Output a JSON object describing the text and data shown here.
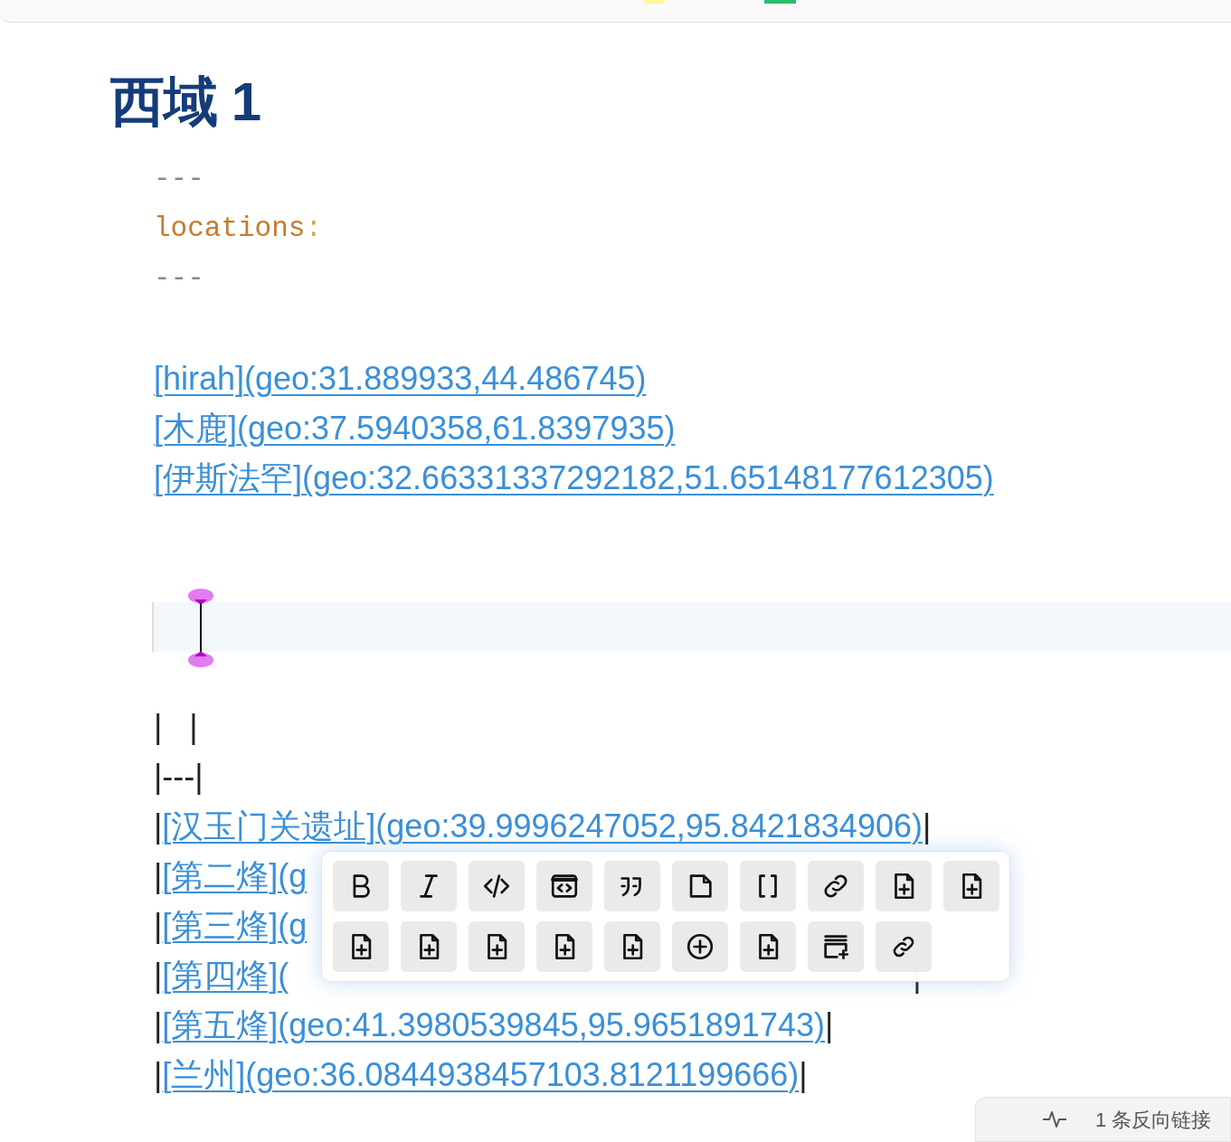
{
  "top_toolbar": {
    "swatches": [
      {
        "color": "#fff59d"
      },
      {
        "color": "#2ebd6b"
      }
    ]
  },
  "title": "西域 1",
  "frontmatter": [
    {
      "kind": "dashes",
      "text": "---"
    },
    {
      "kind": "key",
      "text": "locations",
      "colon": ":"
    },
    {
      "kind": "dashes",
      "text": "---"
    }
  ],
  "links": [
    "[hirah](geo:31.889933,44.486745)",
    "[木鹿](geo:37.5940358,61.8397935)",
    "[伊斯法罕](geo:32.66331337292182,51.65148177612305)"
  ],
  "cursor_line": {
    "active": true
  },
  "table_header": [
    "|   |",
    "|---|"
  ],
  "table_rows": [
    {
      "left": "|",
      "link": "[汉玉门关遗址](geo:39.9996247052,95.8421834906)",
      "right": "|"
    },
    {
      "left": "|",
      "link": "[第二烽](g"
    },
    {
      "left": "|",
      "link": "[第三烽](g"
    },
    {
      "left": "|",
      "link": "[第四烽](",
      "right": "|",
      "kind": "covered"
    },
    {
      "left": "|",
      "link": "[第五烽](geo:41.3980539845,95.9651891743)",
      "right": "|"
    },
    {
      "left": "|",
      "link": "[兰州](geo:36.0844938457103.8121199666)",
      "right": "|"
    }
  ],
  "format_toolbar": [
    {
      "kind": "bold"
    },
    {
      "kind": "italic"
    },
    {
      "kind": "code"
    },
    {
      "kind": "code-block"
    },
    {
      "kind": "quote"
    },
    {
      "kind": "page"
    },
    {
      "kind": "brackets"
    },
    {
      "kind": "link"
    },
    {
      "kind": "file-plus"
    },
    {
      "kind": "file-plus"
    },
    {
      "kind": "file-plus"
    },
    {
      "kind": "file-plus"
    },
    {
      "kind": "file-plus"
    },
    {
      "kind": "file-plus"
    },
    {
      "kind": "file-plus"
    },
    {
      "kind": "circle-plus"
    },
    {
      "kind": "file-plus"
    },
    {
      "kind": "cards-plus"
    },
    {
      "kind": "link-small"
    }
  ],
  "backlinks": {
    "text": "1 条反向链接"
  }
}
